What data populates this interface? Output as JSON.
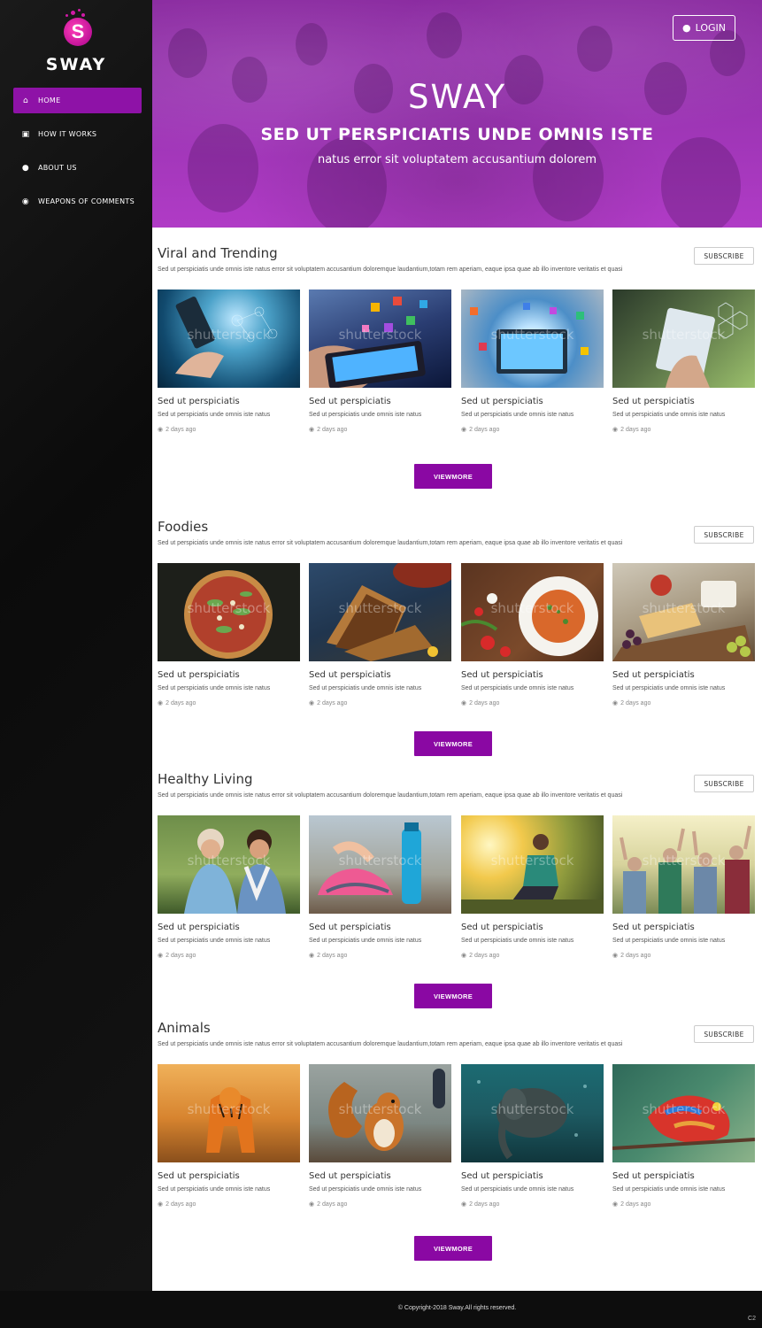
{
  "brand": {
    "name": "SWAY",
    "logo_letter": "S"
  },
  "nav": [
    {
      "label": "HOME",
      "icon": "home-icon",
      "glyph": "⌂",
      "active": true
    },
    {
      "label": "HOW IT WORKS",
      "icon": "briefcase-icon",
      "glyph": "▣",
      "active": false
    },
    {
      "label": "ABOUT US",
      "icon": "user-icon",
      "glyph": "●",
      "active": false
    },
    {
      "label": "WEAPONS OF COMMENTS",
      "icon": "comment-icon",
      "glyph": "◉",
      "active": false
    }
  ],
  "hero": {
    "title": "SWAY",
    "subtitle": "SED UT PERSPICIATIS UNDE OMNIS ISTE",
    "tagline": "natus error sit voluptatem accusantium dolorem",
    "login_label": "LOGIN"
  },
  "sections": [
    {
      "title": "Viral and Trending",
      "description": "Sed ut perspiciatis unde omnis iste natus error sit voluptatem accusantium doloremque laudantium,totam rem aperiam, eaque ipsa quae ab illo inventore veritatis et quasi",
      "subscribe_label": "SUBSCRIBE",
      "viewmore_label": "VIEWMORE",
      "cards": [
        {
          "title": "Sed ut perspiciatis",
          "text": "Sed ut perspiciatis unde omnis iste natus",
          "meta": "2 days ago",
          "image": "hand-network-tech"
        },
        {
          "title": "Sed ut perspiciatis",
          "text": "Sed ut perspiciatis unde omnis iste natus",
          "meta": "2 days ago",
          "image": "phone-app-icons"
        },
        {
          "title": "Sed ut perspiciatis",
          "text": "Sed ut perspiciatis unde omnis iste natus",
          "meta": "2 days ago",
          "image": "tablet-media-burst"
        },
        {
          "title": "Sed ut perspiciatis",
          "text": "Sed ut perspiciatis unde omnis iste natus",
          "meta": "2 days ago",
          "image": "tablet-hexagons"
        }
      ]
    },
    {
      "title": "Foodies",
      "description": "Sed ut perspiciatis unde omnis iste natus error sit voluptatem accusantium doloremque laudantium,totam rem aperiam, eaque ipsa quae ab illo inventore veritatis et quasi",
      "subscribe_label": "SUBSCRIBE",
      "viewmore_label": "VIEWMORE",
      "cards": [
        {
          "title": "Sed ut perspiciatis",
          "text": "Sed ut perspiciatis unde omnis iste natus",
          "meta": "2 days ago",
          "image": "pizza"
        },
        {
          "title": "Sed ut perspiciatis",
          "text": "Sed ut perspiciatis unde omnis iste natus",
          "meta": "2 days ago",
          "image": "grilled-sandwich"
        },
        {
          "title": "Sed ut perspiciatis",
          "text": "Sed ut perspiciatis unde omnis iste natus",
          "meta": "2 days ago",
          "image": "pasta-plate"
        },
        {
          "title": "Sed ut perspiciatis",
          "text": "Sed ut perspiciatis unde omnis iste natus",
          "meta": "2 days ago",
          "image": "cheese-board"
        }
      ]
    },
    {
      "title": "Healthy Living",
      "description": "Sed ut perspiciatis unde omnis iste natus error sit voluptatem accusantium doloremque laudantium,totam rem aperiam, eaque ipsa quae ab illo inventore veritatis et quasi",
      "subscribe_label": "SUBSCRIBE",
      "viewmore_label": "VIEWMORE",
      "cards": [
        {
          "title": "Sed ut perspiciatis",
          "text": "Sed ut perspiciatis unde omnis iste natus",
          "meta": "2 days ago",
          "image": "senior-women"
        },
        {
          "title": "Sed ut perspiciatis",
          "text": "Sed ut perspiciatis unde omnis iste natus",
          "meta": "2 days ago",
          "image": "sneakers-bottle"
        },
        {
          "title": "Sed ut perspiciatis",
          "text": "Sed ut perspiciatis unde omnis iste natus",
          "meta": "2 days ago",
          "image": "sunset-runner"
        },
        {
          "title": "Sed ut perspiciatis",
          "text": "Sed ut perspiciatis unde omnis iste natus",
          "meta": "2 days ago",
          "image": "happy-seniors"
        }
      ]
    },
    {
      "title": "Animals",
      "description": "Sed ut perspiciatis unde omnis iste natus error sit voluptatem accusantium doloremque laudantium,totam rem aperiam, eaque ipsa quae ab illo inventore veritatis et quasi",
      "subscribe_label": "SUBSCRIBE",
      "viewmore_label": "VIEWMORE",
      "cards": [
        {
          "title": "Sed ut perspiciatis",
          "text": "Sed ut perspiciatis unde omnis iste natus",
          "meta": "2 days ago",
          "image": "tiger"
        },
        {
          "title": "Sed ut perspiciatis",
          "text": "Sed ut perspiciatis unde omnis iste natus",
          "meta": "2 days ago",
          "image": "squirrel"
        },
        {
          "title": "Sed ut perspiciatis",
          "text": "Sed ut perspiciatis unde omnis iste natus",
          "meta": "2 days ago",
          "image": "elephant-underwater"
        },
        {
          "title": "Sed ut perspiciatis",
          "text": "Sed ut perspiciatis unde omnis iste natus",
          "meta": "2 days ago",
          "image": "chameleon"
        }
      ]
    }
  ],
  "watermark": "shutterstock",
  "footer": {
    "copyright": "© Copyright-2018 Sway.All rights reserved.",
    "code": "C2"
  },
  "colors": {
    "accent": "#8a08a3",
    "sidebar": "#111111",
    "hero": "#9a34b2"
  }
}
